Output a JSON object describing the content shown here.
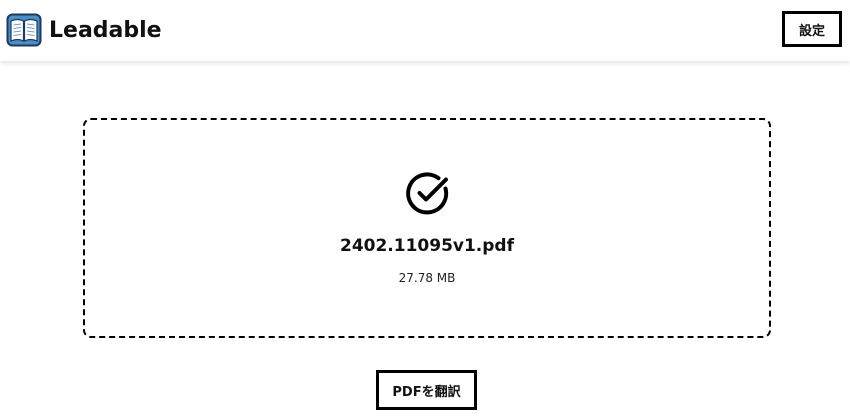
{
  "header": {
    "app_title": "Leadable",
    "logo_icon": "book-icon",
    "settings_label": "設定"
  },
  "upload": {
    "status_icon": "check-circle-icon",
    "file_name": "2402.11095v1.pdf",
    "file_size": "27.78 MB"
  },
  "actions": {
    "translate_label": "PDFを翻訳"
  },
  "colors": {
    "border": "#000000",
    "logo_cover": "#4a8fc8",
    "logo_outline": "#1d3a5c"
  }
}
